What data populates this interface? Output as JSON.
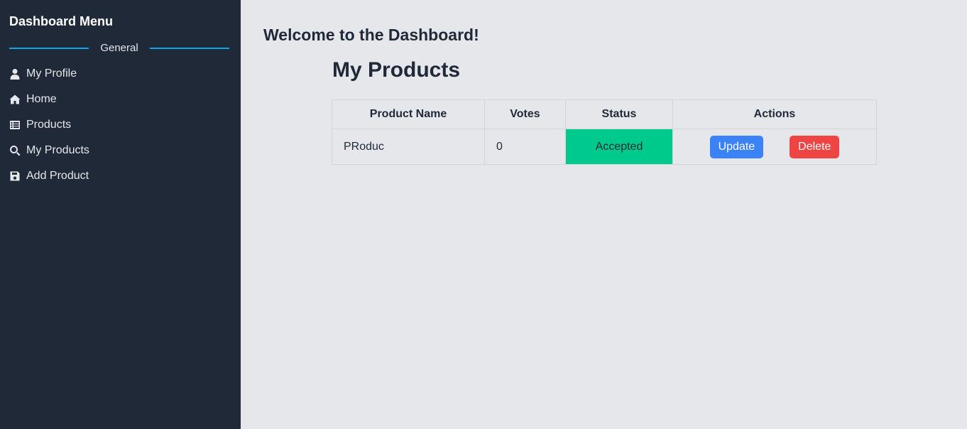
{
  "sidebar": {
    "title": "Dashboard Menu",
    "section_label": "General",
    "items": [
      {
        "label": "My Profile",
        "icon": "user-icon"
      },
      {
        "label": "Home",
        "icon": "home-icon"
      },
      {
        "label": "Products",
        "icon": "list-icon"
      },
      {
        "label": "My Products",
        "icon": "search-icon"
      },
      {
        "label": "Add Product",
        "icon": "save-icon"
      }
    ]
  },
  "main": {
    "welcome": "Welcome to the Dashboard!",
    "title": "My Products",
    "table": {
      "headers": [
        "Product Name",
        "Votes",
        "Status",
        "Actions"
      ],
      "rows": [
        {
          "name": "PRoduc",
          "votes": "0",
          "status": "Accepted",
          "update_label": "Update",
          "delete_label": "Delete"
        }
      ]
    }
  },
  "colors": {
    "sidebar_bg": "#1f2937",
    "accent_line": "#0ea5e9",
    "status_accepted": "#00c98d",
    "update_button": "#3b82f6",
    "delete_button": "#ef4444"
  }
}
